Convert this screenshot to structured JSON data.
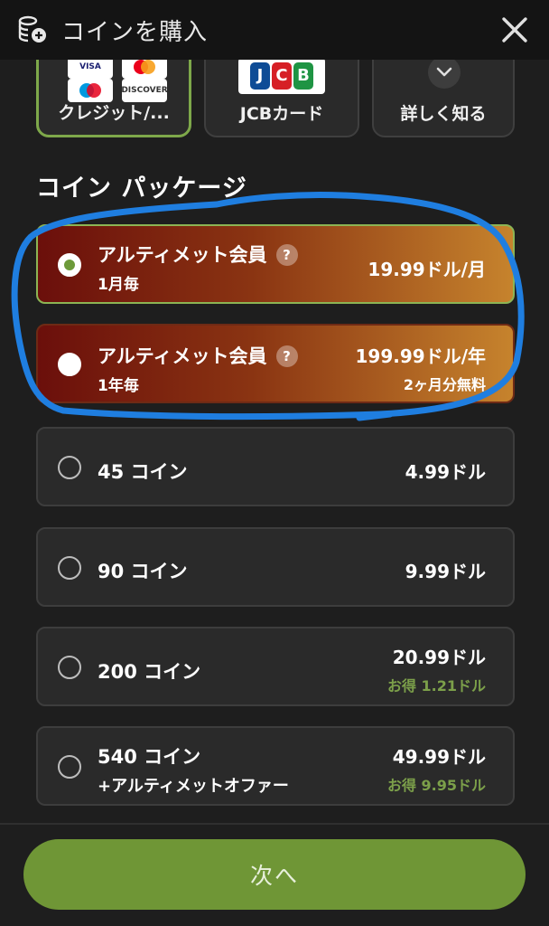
{
  "header": {
    "title": "コインを購入",
    "logo_icon": "coin-stack-icon",
    "close_icon": "close-icon"
  },
  "payment_methods": [
    {
      "label": "クレジット/...",
      "logos": [
        "VISA",
        "",
        "",
        "DISCOVER"
      ],
      "selected": true
    },
    {
      "label": "JCBカード",
      "logos": [
        "JCB"
      ],
      "selected": false
    },
    {
      "label": "詳しく知る",
      "icon": "chevron-down-icon",
      "selected": false
    }
  ],
  "section_title": "コイン パッケージ",
  "packages": [
    {
      "name": "アルティメット会員",
      "sub": "1月毎",
      "price": "19.99ドル/月",
      "subprice": "",
      "selected": true,
      "help": "?"
    },
    {
      "name": "アルティメット会員",
      "sub": "1年毎",
      "price": "199.99ドル/年",
      "subprice": "2ヶ月分無料",
      "selected": false,
      "help": "?"
    },
    {
      "name": "45 コイン",
      "price": "4.99ドル"
    },
    {
      "name": "90 コイン",
      "price": "9.99ドル"
    },
    {
      "name": "200 コイン",
      "price": "20.99ドル",
      "subprice": "お得 1.21ドル"
    },
    {
      "name": "540 コイン",
      "sub": "+アルティメットオファー",
      "price": "49.99ドル",
      "subprice": "お得 9.95ドル"
    }
  ],
  "next_button": "次へ",
  "colors": {
    "accent_green": "#7ca04a",
    "button_green": "#6f9636",
    "offer_orange": "#e2662a",
    "annotation_blue": "#1f7ee0"
  }
}
